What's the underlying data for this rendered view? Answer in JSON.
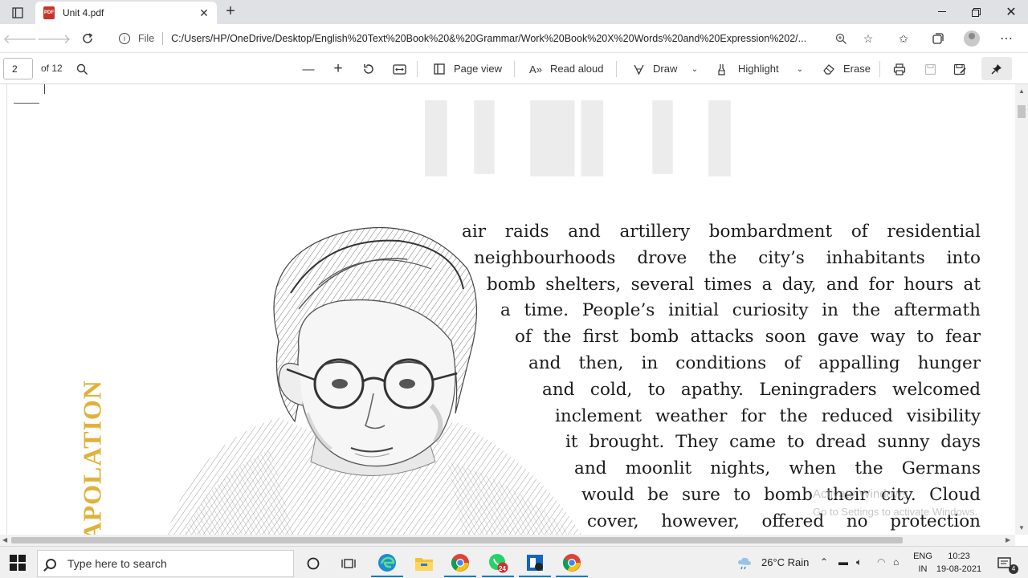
{
  "browser": {
    "tab_title": "Unit 4.pdf",
    "pdf_badge": "PDF",
    "url_scheme": "File",
    "url": "C:/Users/HP/OneDrive/Desktop/English%20Text%20Book%20&%20Grammar/Work%20Book%20X%20Words%20and%20Expression%202/..."
  },
  "pdf_toolbar": {
    "page_number": "2",
    "page_count": "of 12",
    "page_view": "Page view",
    "read_aloud": "Read aloud",
    "draw": "Draw",
    "highlight": "Highlight",
    "erase": "Erase"
  },
  "document": {
    "sidebar_word": "APOLATION",
    "paragraph_lines": [
      "air raids and artillery bombardment of residential",
      "neighbourhoods drove the city’s inhabitants into",
      "bomb shelters, several times a day, and for hours at",
      "a time. People’s initial curiosity in the aftermath",
      "of the first bomb attacks soon gave way to fear",
      "and then, in conditions of appalling hunger",
      "and cold, to apathy. Leningraders welcomed",
      "inclement weather for the reduced visibility",
      "it brought. They came to dread sunny days",
      "and moonlit nights, when the Germans",
      "would be sure to bomb their city. Cloud",
      "cover, however, offered no protection"
    ],
    "watermark_line1": "Activate Windows",
    "watermark_line2": "Go to Settings to activate Windows."
  },
  "taskbar": {
    "search_placeholder": "Type here to search",
    "weather": "26°C  Rain",
    "lang_line1": "ENG",
    "lang_line2": "IN",
    "time": "10:23",
    "date": "19-08-2021",
    "whatsapp_badge": "24",
    "notification_count": "4"
  },
  "colors": {
    "sidebar_word": "#e0b23a",
    "pdf_badge": "#c8342a"
  }
}
